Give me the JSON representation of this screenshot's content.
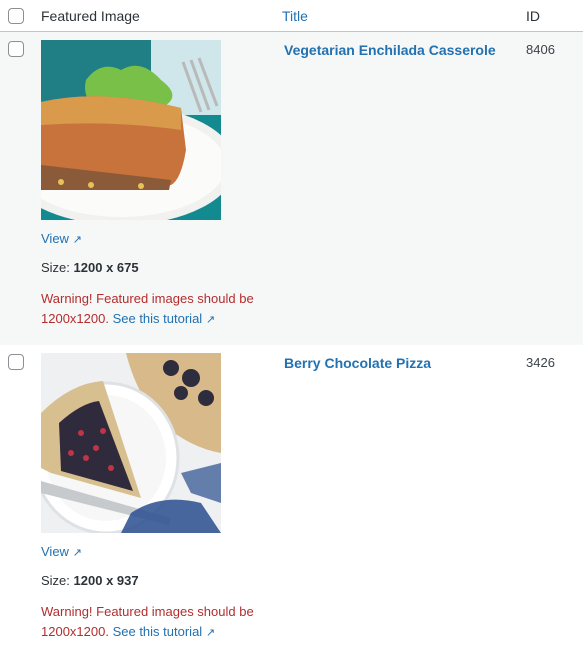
{
  "header": {
    "featured_image": "Featured Image",
    "title": "Title",
    "id": "ID"
  },
  "rows": [
    {
      "title": "Vegetarian Enchilada Casserole",
      "id": "8406",
      "image_alt": "Vegetarian enchilada casserole on a white plate",
      "view_label": "View",
      "size_label": "Size:",
      "size_value": "1200 x 675",
      "warning_text": "Warning! Featured images should be 1200x1200.",
      "tutorial_link": "See this tutorial",
      "background": "#f6f7f7"
    },
    {
      "title": "Berry Chocolate Pizza",
      "id": "3426",
      "image_alt": "Berry chocolate pizza slice on a white plate",
      "view_label": "View",
      "size_label": "Size:",
      "size_value": "1200 x 937",
      "warning_text": "Warning! Featured images should be 1200x1200.",
      "tutorial_link": "See this tutorial",
      "background": "#ffffff"
    }
  ],
  "icons": {
    "external_link": "↗"
  },
  "colors": {
    "link": "#2271b1",
    "warning": "#b32d2e",
    "text": "#2c3338",
    "alt_row": "#f6f7f7"
  }
}
